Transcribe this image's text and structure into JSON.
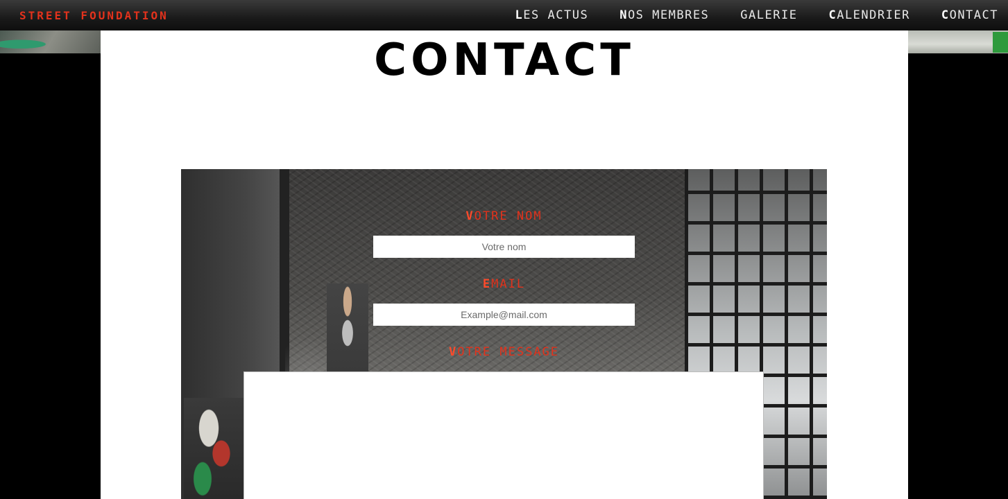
{
  "header": {
    "brand": "STREET FOUNDATION",
    "nav": [
      {
        "first": "L",
        "rest": "ES ACTUS"
      },
      {
        "first": "N",
        "rest": "OS MEMBRES"
      },
      {
        "first": "",
        "rest": "GALERIE"
      },
      {
        "first": "C",
        "rest": "ALENDRIER"
      },
      {
        "first": "C",
        "rest": "ONTACT"
      }
    ]
  },
  "page": {
    "title": "CONTACT"
  },
  "form": {
    "name": {
      "label_first": "V",
      "label_rest": "OTRE NOM",
      "placeholder": "Votre nom"
    },
    "email": {
      "label_first": "E",
      "label_rest": "MAIL",
      "placeholder": "Example@mail.com"
    },
    "message": {
      "label_first": "V",
      "label_rest": "OTRE MESSAGE"
    }
  }
}
